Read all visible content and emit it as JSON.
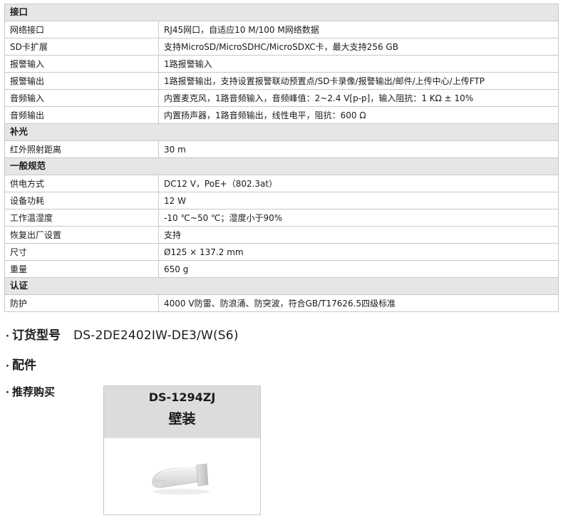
{
  "spec_sections": [
    {
      "title": "接口",
      "rows": [
        {
          "label": "网络接口",
          "value": "RJ45网口，自适应10 M/100 M网络数据"
        },
        {
          "label": "SD卡扩展",
          "value": "支持MicroSD/MicroSDHC/MicroSDXC卡，最大支持256 GB"
        },
        {
          "label": "报警输入",
          "value": "1路报警输入"
        },
        {
          "label": "报警输出",
          "value": "1路报警输出，支持设置报警联动预置点/SD卡录像/报警输出/邮件/上传中心/上传FTP"
        },
        {
          "label": "音频输入",
          "value": "内置麦克风，1路音频输入，音频峰值：2~2.4 V[p-p]，输入阻抗：1 KΩ ± 10%"
        },
        {
          "label": "音频输出",
          "value": "内置扬声器，1路音频输出，线性电平，阻抗：600 Ω"
        }
      ]
    },
    {
      "title": "补光",
      "rows": [
        {
          "label": "红外照射距离",
          "value": "30 m"
        }
      ]
    },
    {
      "title": "一般规范",
      "rows": [
        {
          "label": "供电方式",
          "value": "DC12 V，PoE+（802.3at）"
        },
        {
          "label": "设备功耗",
          "value": "12 W"
        },
        {
          "label": "工作温湿度",
          "value": "-10 ℃~50 ℃；湿度小于90%"
        },
        {
          "label": "恢复出厂设置",
          "value": "支持"
        },
        {
          "label": "尺寸",
          "value": "Ø125 × 137.2 mm"
        },
        {
          "label": "重量",
          "value": "650 g"
        }
      ]
    },
    {
      "title": "认证",
      "rows": [
        {
          "label": "防护",
          "value": "4000 V防雷、防浪涌、防突波，符合GB/T17626.5四级标准"
        }
      ]
    }
  ],
  "order_section": {
    "bullet": "·",
    "title": "订货型号",
    "model": "DS-2DE2402IW-DE3/W(S6)"
  },
  "accessories_section": {
    "bullet": "·",
    "title": "配件"
  },
  "recommend_section": {
    "bullet": "·",
    "title": "推荐购买"
  },
  "product_card": {
    "model": "DS-1294ZJ",
    "name": "壁装",
    "image_icon": "wall-mount-bracket-icon"
  },
  "colors": {
    "section_bg": "#e6e6e6",
    "border": "#c8c8c8",
    "card_head_bg": "#dcdcdc"
  }
}
